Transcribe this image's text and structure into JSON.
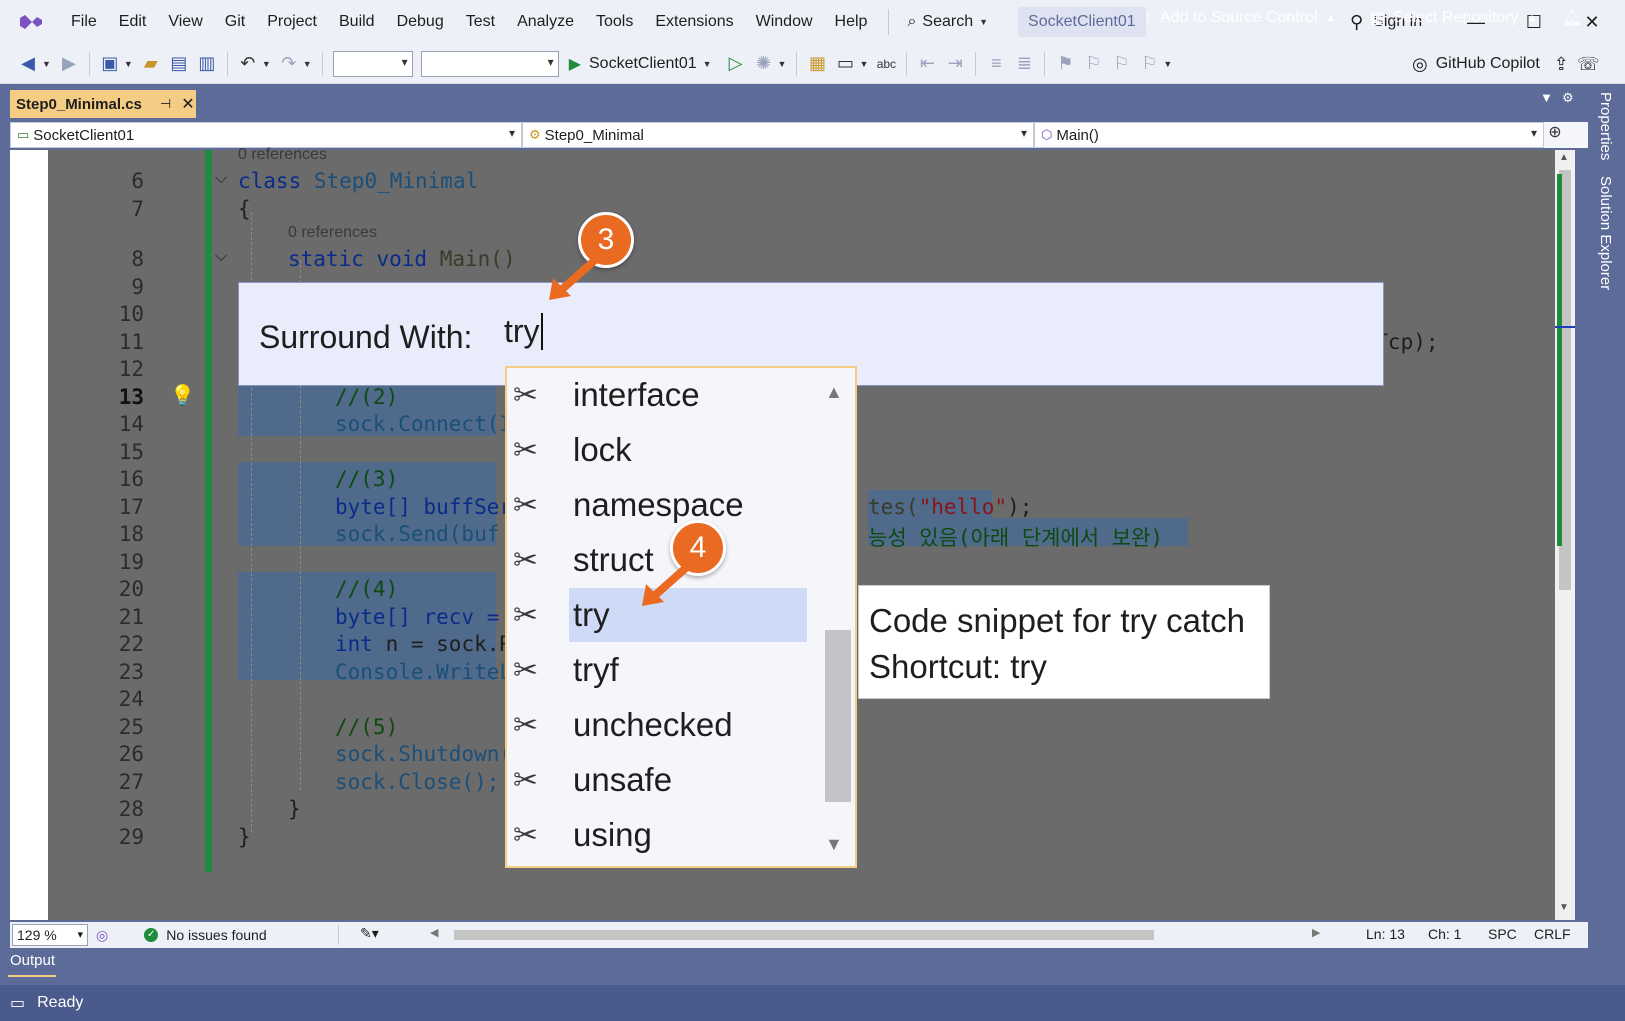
{
  "menu": {
    "items": [
      "File",
      "Edit",
      "View",
      "Git",
      "Project",
      "Build",
      "Debug",
      "Test",
      "Analyze",
      "Tools",
      "Extensions",
      "Window",
      "Help"
    ],
    "search_label": "Search",
    "solution_name": "SocketClient01",
    "sign_in": "Sign in"
  },
  "toolbar": {
    "run_target": "SocketClient01",
    "copilot_label": "GitHub Copilot"
  },
  "tab": {
    "title": "Step0_Minimal.cs"
  },
  "navbar": {
    "project": "SocketClient01",
    "type": "Step0_Minimal",
    "member": "Main()"
  },
  "editor": {
    "line_numbers": [
      "6",
      "7",
      "8",
      "9",
      "10",
      "11",
      "12",
      "13",
      "14",
      "15",
      "16",
      "17",
      "18",
      "19",
      "20",
      "21",
      "22",
      "23",
      "24",
      "25",
      "26",
      "27",
      "28",
      "29"
    ],
    "current_line": "13",
    "refs_class": "0 references",
    "refs_main": "0 references",
    "code": {
      "l6_kw": "class",
      "l6_name": "Step0_Minimal",
      "l7": "{",
      "l8_kw": "static void",
      "l8_name": "Main()",
      "l11_tail": "e.Tcp);",
      "l13": "//(2)",
      "l14": "sock.Connect(I",
      "l16": "//(3)",
      "l17_head": "byte[] buffSer",
      "l17_tail_a": "tes(",
      "l17_str": "\"hello\"",
      "l17_tail_b": ");",
      "l18_head": "sock.Send(buf",
      "l18_tail": "능성 있음(아래 단계에서 보완)",
      "l20": "//(4)",
      "l21": "byte[] recv =",
      "l22_kw": "int",
      "l22_rest": " n = sock.R",
      "l23": "Console.WriteL",
      "l25": "//(5)",
      "l26": "sock.Shutdown(",
      "l27": "sock.Close();",
      "l28": "}",
      "l29": "}"
    }
  },
  "surround": {
    "label": "Surround With:",
    "input_value": "try"
  },
  "completion": {
    "items": [
      "interface",
      "lock",
      "namespace",
      "struct",
      "try",
      "tryf",
      "unchecked",
      "unsafe",
      "using"
    ],
    "selected": "try",
    "item_icon": "snippet-icon"
  },
  "tooltip": {
    "line1": "Code snippet for try catch",
    "line2": "Shortcut: try"
  },
  "badges": {
    "step3": "3",
    "step4": "4"
  },
  "editor_status": {
    "zoom": "129 %",
    "issues": "No issues found",
    "ln": "Ln: 13",
    "ch": "Ch: 1",
    "spc": "SPC",
    "crlf": "CRLF"
  },
  "output_label": "Output",
  "statusbar": {
    "ready": "Ready",
    "add_source": "Add to Source Control",
    "select_repo": "Select Repository"
  },
  "sidedock": {
    "properties": "Properties",
    "solution_explorer": "Solution Explorer"
  },
  "colors": {
    "accent_orange": "#ea6a22",
    "tab_active": "#f5cc84",
    "chrome_blue": "#5d6b99",
    "status_bar": "#4a5a8c"
  }
}
